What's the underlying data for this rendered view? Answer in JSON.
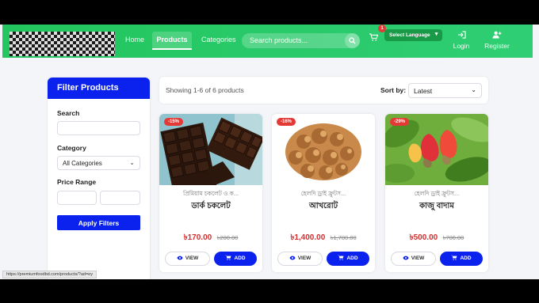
{
  "nav": {
    "links": [
      "Home",
      "Products",
      "Categories"
    ],
    "search_placeholder": "Search products...",
    "cart_count": "1",
    "language": "Select Language",
    "login": "Login",
    "register": "Register"
  },
  "sidebar": {
    "title": "Filter Products",
    "search_label": "Search",
    "category_label": "Category",
    "category_value": "All Categories",
    "price_label": "Price Range",
    "apply": "Apply Filters"
  },
  "results": {
    "showing": "Showing 1-6 of 6 products",
    "sort_label": "Sort by:",
    "sort_value": "Latest"
  },
  "products": [
    {
      "badge": "-15%",
      "sub": "প্রিমিয়াম চকলেট ও ক...",
      "name": "ডার্ক চকলেট",
      "price": "৳170.00",
      "old_price": "৳200.00"
    },
    {
      "badge": "-16%",
      "sub": "হেলদি ড্রাই ফ্রুটস...",
      "name": "আখরোট",
      "price": "৳1,400.00",
      "old_price": "৳1,700.00"
    },
    {
      "badge": "-29%",
      "sub": "হেলদি ড্রাই ফ্রুটস...",
      "name": "কাজু বাদাম",
      "price": "৳500.00",
      "old_price": "৳700.00"
    }
  ],
  "buttons": {
    "view": "VIEW",
    "add": "ADD"
  },
  "status_url": "https://premiumfoodbd.com/products/?ad=ey",
  "colors": {
    "nav_green": "#22c55e",
    "primary_blue": "#0b22ee",
    "discount_red": "#e53935",
    "price_red": "#d32f2f"
  }
}
